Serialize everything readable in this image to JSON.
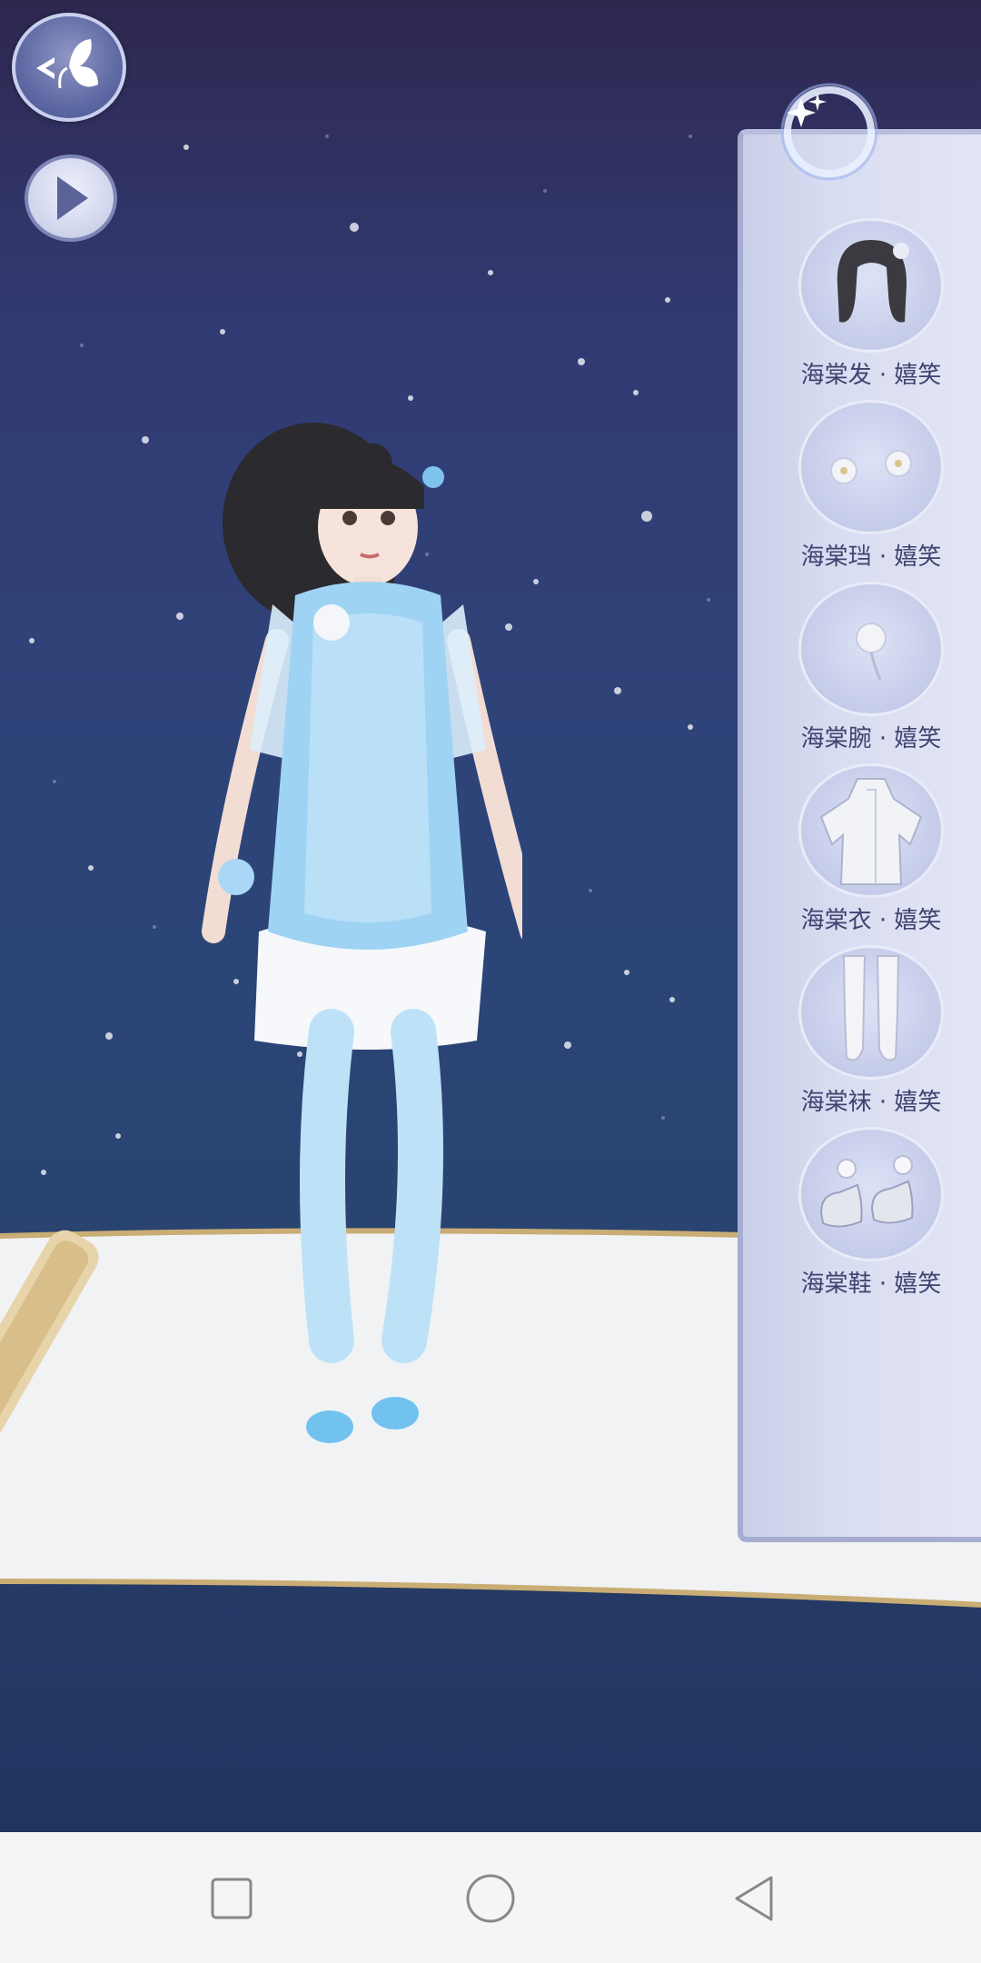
{
  "scene": {
    "character": "girl-in-blue-qipao",
    "colors": {
      "sky_top": "#2e2850",
      "sky_bottom": "#1f3560",
      "panel": "#d9ddf1",
      "label": "#3e4470"
    }
  },
  "top_controls": {
    "back_icon": "butterfly-back-icon",
    "play_icon": "play-icon"
  },
  "outfit_panel": {
    "items": [
      {
        "label": "海棠发 · 嬉笑",
        "icon": "hair-icon"
      },
      {
        "label": "海棠珰 · 嬉笑",
        "icon": "earrings-icon"
      },
      {
        "label": "海棠腕 · 嬉笑",
        "icon": "wrist-flower-icon"
      },
      {
        "label": "海棠衣 · 嬉笑",
        "icon": "dress-icon"
      },
      {
        "label": "海棠袜 · 嬉笑",
        "icon": "stockings-icon"
      },
      {
        "label": "海棠鞋 · 嬉笑",
        "icon": "shoes-icon"
      }
    ]
  },
  "system_nav": {
    "recent_icon": "square-recents-icon",
    "home_icon": "circle-home-icon",
    "back_icon": "triangle-back-icon"
  }
}
